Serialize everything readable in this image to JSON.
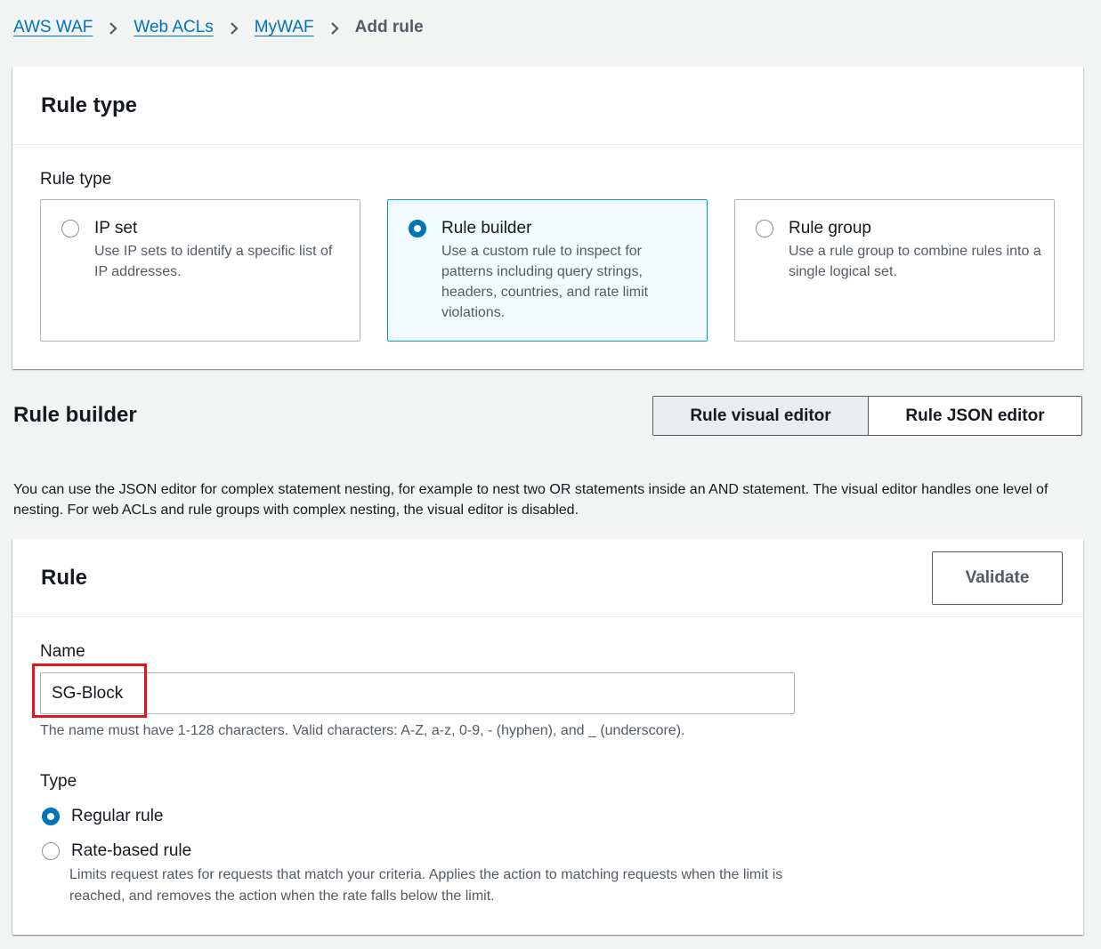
{
  "breadcrumb": {
    "items": [
      "AWS WAF",
      "Web ACLs",
      "MyWAF"
    ],
    "current": "Add rule"
  },
  "rule_type_panel": {
    "title": "Rule type",
    "field_label": "Rule type",
    "options": [
      {
        "title": "IP set",
        "description": "Use IP sets to identify a specific list of IP addresses.",
        "selected": false
      },
      {
        "title": "Rule builder",
        "description": "Use a custom rule to inspect for patterns including query strings, headers, countries, and rate limit violations.",
        "selected": true
      },
      {
        "title": "Rule group",
        "description": "Use a rule group to combine rules into a single logical set.",
        "selected": false
      }
    ]
  },
  "rule_builder": {
    "title": "Rule builder",
    "editor_tabs": [
      "Rule visual editor",
      "Rule JSON editor"
    ],
    "active_editor": "Rule visual editor",
    "help_text": "You can use the JSON editor for complex statement nesting, for example to nest two OR statements inside an AND statement. The visual editor handles one level of nesting. For web ACLs and rule groups with complex nesting, the visual editor is disabled."
  },
  "rule_panel": {
    "title": "Rule",
    "validate_label": "Validate",
    "name_label": "Name",
    "name_value": "SG-Block",
    "name_constraint": "The name must have 1-128 characters. Valid characters: A-Z, a-z, 0-9, - (hyphen), and _ (underscore).",
    "type_label": "Type",
    "type_options": [
      {
        "label": "Regular rule",
        "selected": true
      },
      {
        "label": "Rate-based rule",
        "selected": false
      }
    ],
    "rate_description": "Limits request rates for requests that match your criteria. Applies the action to matching requests when the limit is reached, and removes the action when the rate falls below the limit."
  },
  "colors": {
    "link": "#0073bb",
    "selected_tile_bg": "#f1faff",
    "selected_tile_border": "#00a1c9",
    "highlight": "#e0141c"
  }
}
